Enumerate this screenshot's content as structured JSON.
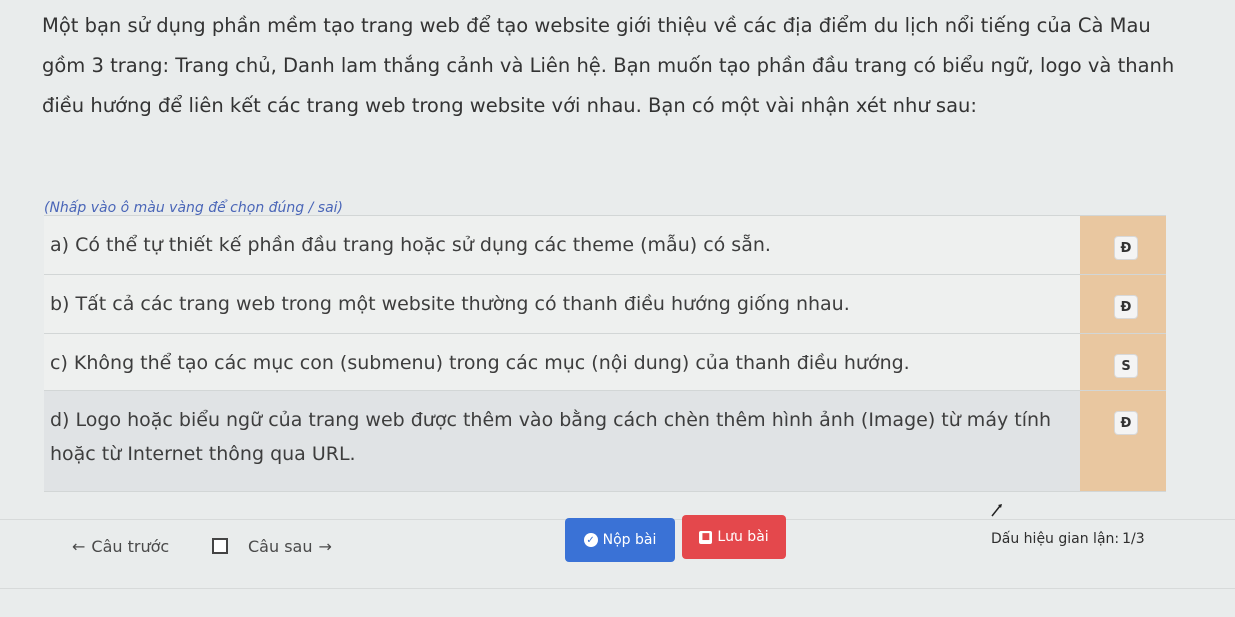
{
  "question": {
    "text": "Một bạn sử dụng phần mềm tạo trang web để tạo website giới thiệu về các địa điểm du lịch nổi tiếng của Cà Mau gồm 3 trang: Trang chủ, Danh lam thắng cảnh và Liên hệ. Bạn muốn tạo phần đầu trang có biểu ngữ, logo và thanh điều hướng để liên kết các trang web trong website với nhau. Bạn có một vài nhận xét như sau:"
  },
  "hint": "(Nhấp vào ô màu vàng để chọn đúng / sai)",
  "options": [
    {
      "text": "a) Có thể tự thiết kế phần đầu trang hoặc sử dụng các theme (mẫu) có sẵn.",
      "answer": "Đ"
    },
    {
      "text": "b) Tất cả các trang web trong một website thường có thanh điều hướng giống nhau.",
      "answer": "Đ"
    },
    {
      "text": "c) Không thể tạo các mục con (submenu) trong các mục (nội dung) của thanh điều hướng.",
      "answer": "S"
    },
    {
      "text": "d) Logo hoặc biểu ngữ của trang web được thêm vào bằng cách chèn thêm hình ảnh (Image) từ máy tính hoặc từ Internet thông qua URL.",
      "answer": "Đ"
    }
  ],
  "nav": {
    "prev_label": "Câu trước",
    "next_label": "Câu sau"
  },
  "buttons": {
    "submit_label": "Nộp bài",
    "save_label": "Lưu bài"
  },
  "fraud": {
    "label": "Dấu hiệu gian lận:",
    "value": "1/3"
  }
}
